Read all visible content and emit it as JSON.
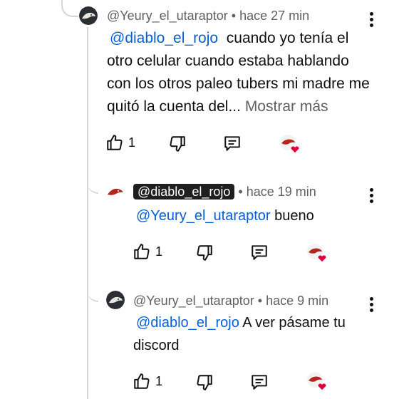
{
  "comments": [
    {
      "author": "@Yeury_el_utaraptor",
      "separator": "•",
      "time": "hace 27 min",
      "mention": "@diablo_el_rojo",
      "text": "cuando yo tenía el otro celular cuando estaba hablando con los otros paleo tubers mi madre me quitó la cuenta del...",
      "more": "Mostrar más",
      "likes": "1"
    },
    {
      "author": "@diablo_el_rojo",
      "separator": "•",
      "time": "hace 19 min",
      "mention": "@Yeury_el_utaraptor",
      "text": "bueno",
      "likes": "1"
    },
    {
      "author": "@Yeury_el_utaraptor",
      "separator": "•",
      "time": "hace 9 min",
      "mention": "@diablo_el_rojo",
      "text": "A ver pásame tu discord",
      "likes": "1"
    }
  ],
  "icons": {
    "like": "thumbs-up-icon",
    "dislike": "thumbs-down-icon",
    "reply": "reply-icon",
    "more": "more-vert-icon",
    "creator_heart": "creator-heart-icon"
  },
  "colors": {
    "mention": "#065fd4",
    "meta": "#606060",
    "heart": "#e0003c",
    "chip": "#1f1f1f"
  }
}
